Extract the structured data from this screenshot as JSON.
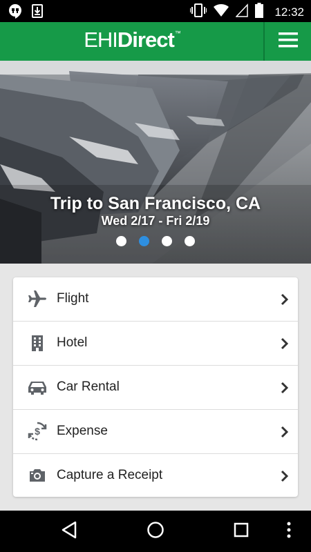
{
  "status_bar": {
    "time": "12:32",
    "icons": [
      "hangouts-icon",
      "download-icon",
      "vibrate-icon",
      "wifi-icon",
      "signal-icon",
      "battery-icon"
    ]
  },
  "app_bar": {
    "brand_light": "EHI",
    "brand_bold": "Direct",
    "brand_mark": "™",
    "color": "#169a48"
  },
  "hero": {
    "title": "Trip to San Francisco, CA",
    "dates": "Wed 2/17 - Fri 2/19",
    "carousel": {
      "pages": 4,
      "active_index": 1,
      "active_color": "#2e8fe0"
    }
  },
  "menu": {
    "items": [
      {
        "label": "Flight",
        "icon": "airplane-icon"
      },
      {
        "label": "Hotel",
        "icon": "hotel-building-icon"
      },
      {
        "label": "Car Rental",
        "icon": "car-icon"
      },
      {
        "label": "Expense",
        "icon": "expense-dollar-icon"
      },
      {
        "label": "Capture a Receipt",
        "icon": "camera-icon"
      }
    ]
  },
  "nav_bar": {
    "buttons": [
      "back-icon",
      "home-icon",
      "recents-icon",
      "overflow-menu-icon"
    ]
  }
}
